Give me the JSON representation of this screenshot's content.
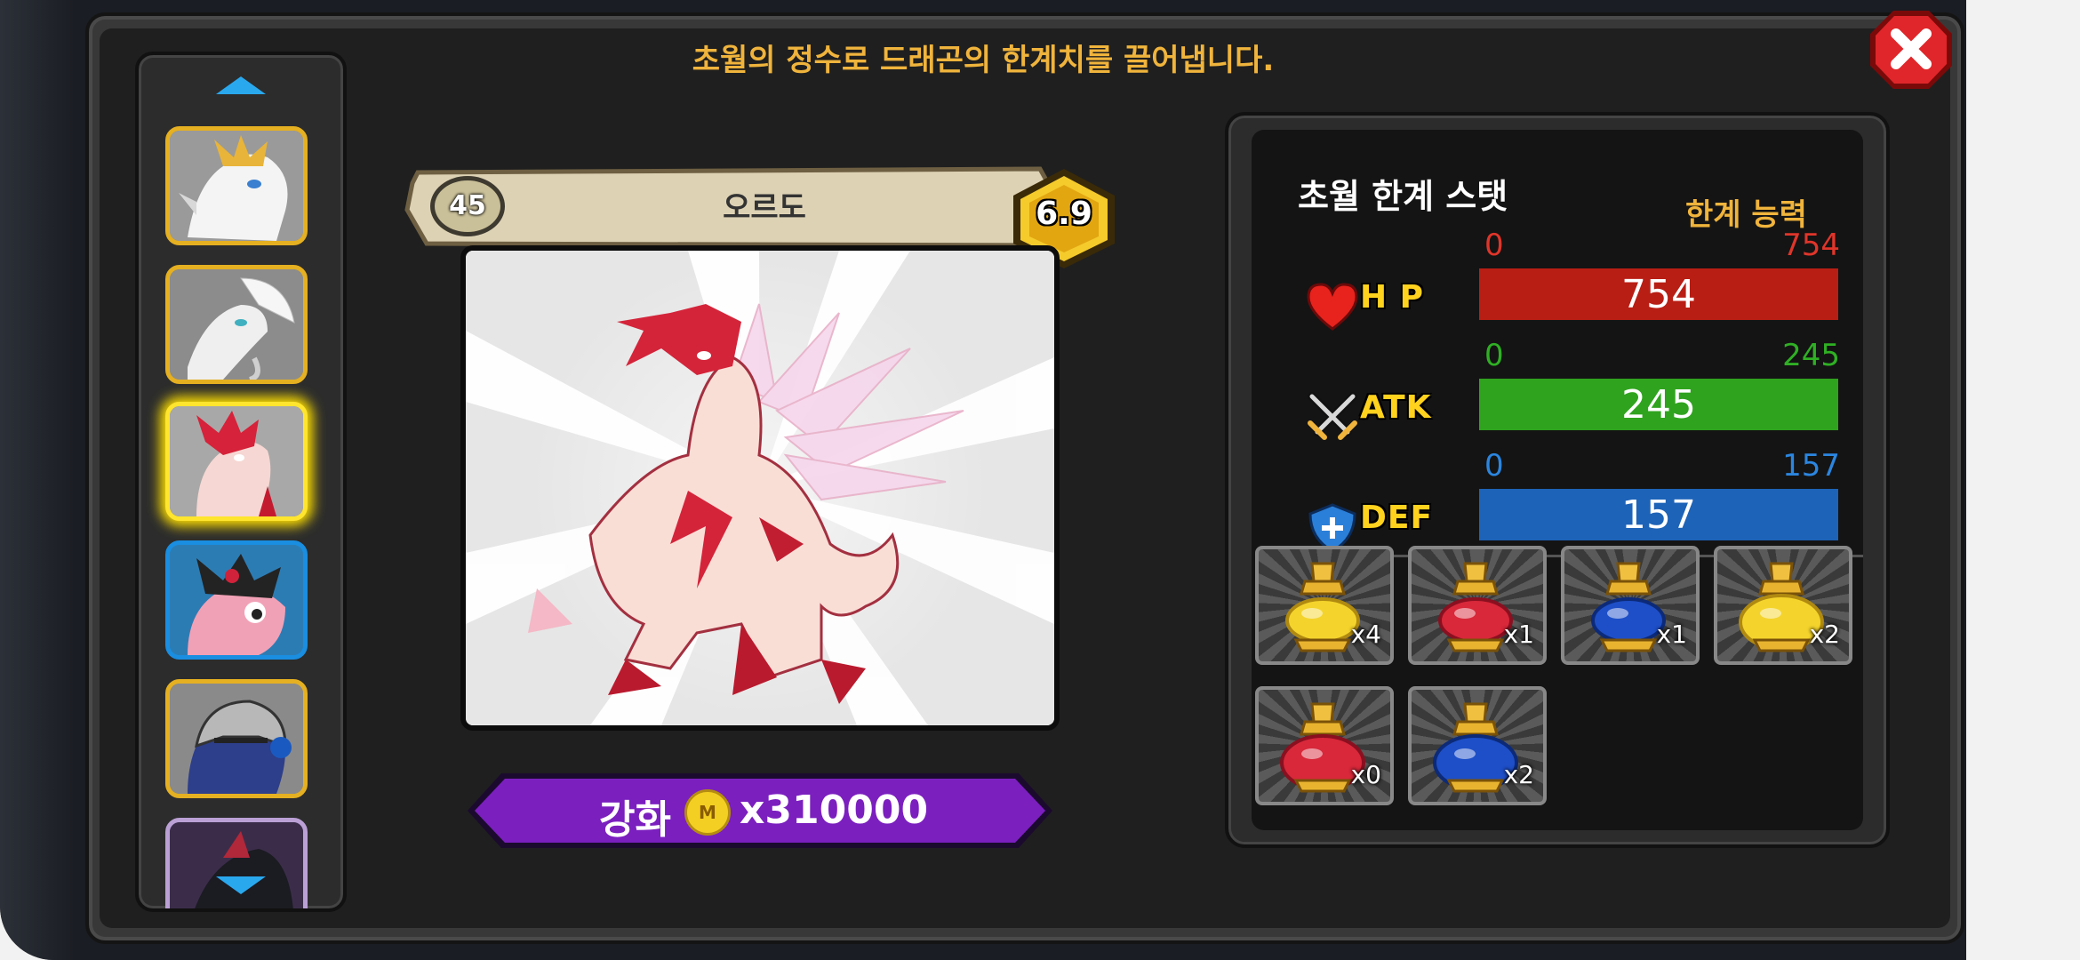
{
  "header": {
    "description": "초월의 정수로 드래곤의 한계치를 끌어냅니다."
  },
  "dragon": {
    "name": "오르도",
    "level": "45",
    "grade": "6.9"
  },
  "enhance": {
    "label": "강화",
    "coin_symbol": "M",
    "cost": "x310000"
  },
  "stats": {
    "title": "초월 한계 스탯",
    "subtitle": "한계 능력",
    "rows": [
      {
        "name": "H P",
        "min": "0",
        "max": "754",
        "value": "754",
        "fill": 1.0,
        "color": "#b81e14",
        "label_color": "#e0352a"
      },
      {
        "name": "ATK",
        "min": "0",
        "max": "245",
        "value": "245",
        "fill": 1.0,
        "color": "#2fa31e",
        "label_color": "#2fb024"
      },
      {
        "name": "DEF",
        "min": "0",
        "max": "157",
        "value": "157",
        "fill": 1.0,
        "color": "#1d63b8",
        "label_color": "#2b86e0"
      }
    ]
  },
  "items": [
    {
      "count": "x4",
      "color": "yellow"
    },
    {
      "count": "x1",
      "color": "red"
    },
    {
      "count": "x1",
      "color": "blue"
    },
    {
      "count": "x2",
      "color": "yellow"
    },
    {
      "count": "x0",
      "color": "red"
    },
    {
      "count": "x2",
      "color": "blue"
    }
  ],
  "sidebar": {
    "dragons": [
      {
        "icon": "white-gold-dragon"
      },
      {
        "icon": "white-feather-dragon"
      },
      {
        "icon": "pink-crystal-dragon",
        "selected": true
      },
      {
        "icon": "pink-black-dragon"
      },
      {
        "icon": "armored-blue-dragon"
      },
      {
        "icon": "dark-dragon"
      }
    ]
  }
}
